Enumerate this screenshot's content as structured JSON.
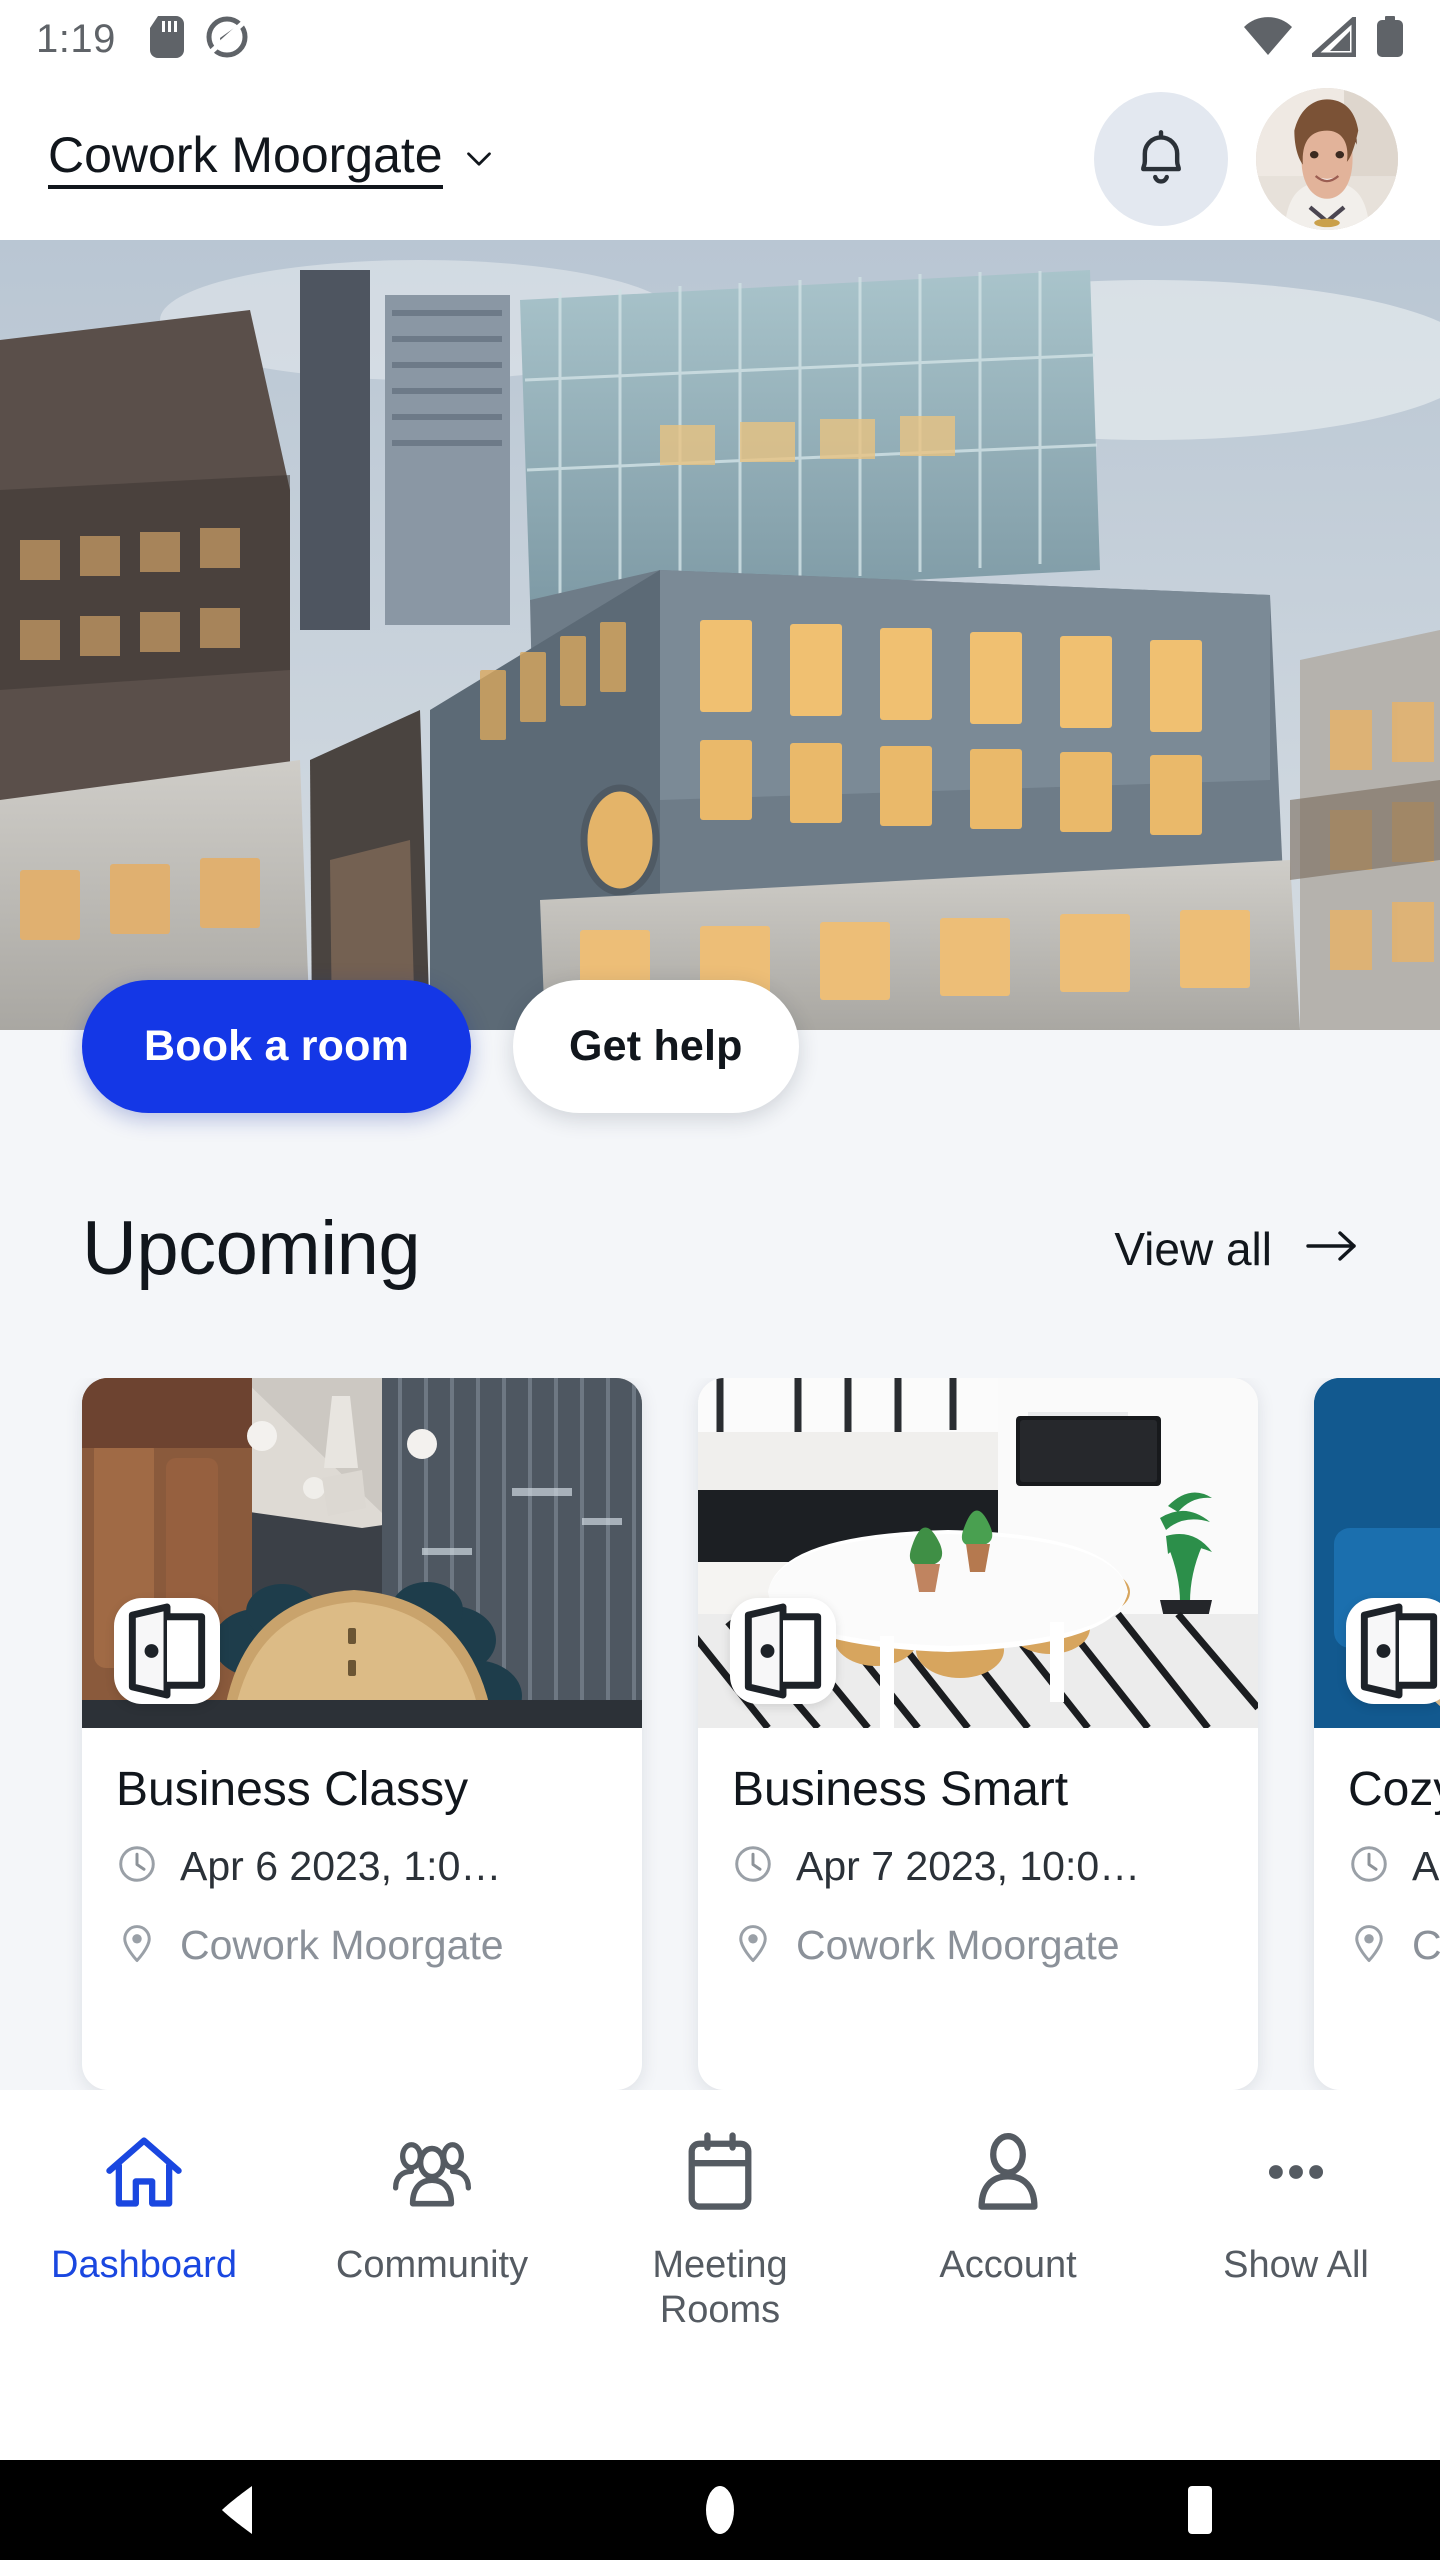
{
  "status_bar": {
    "time": "1:19",
    "left_icons": [
      "sd-card-icon",
      "screen-capture-icon"
    ],
    "right_icons": [
      "wifi-icon",
      "cellular-signal-icon",
      "battery-icon"
    ]
  },
  "header": {
    "venue_name": "Cowork Moorgate",
    "chevron": "chevron-down-icon",
    "notifications": "bell-icon",
    "avatar": "user-avatar"
  },
  "hero": {
    "alt": "aerial-view-of-london-office-buildings-at-dusk"
  },
  "cta": {
    "primary_label": "Book a room",
    "secondary_label": "Get help"
  },
  "upcoming": {
    "title": "Upcoming",
    "view_all_label": "View all",
    "view_all_icon": "arrow-right-icon",
    "cards": [
      {
        "title": "Business Classy",
        "time": "Apr 6 2023, 1:0…",
        "location": "Cowork Moorgate",
        "badge_icon": "open-door-icon"
      },
      {
        "title": "Business Smart",
        "time": "Apr 7 2023, 10:0…",
        "location": "Cowork Moorgate",
        "badge_icon": "open-door-icon"
      },
      {
        "title": "Cozy",
        "time": "A",
        "location": "C",
        "badge_icon": "open-door-icon"
      }
    ]
  },
  "bottom_nav": {
    "active_color": "#1a47e0",
    "inactive_color": "#555b62",
    "items": [
      {
        "label": "Dashboard",
        "icon": "home-icon",
        "active": true
      },
      {
        "label": "Community",
        "icon": "people-icon",
        "active": false
      },
      {
        "label": "Meeting Rooms",
        "icon": "calendar-icon",
        "active": false
      },
      {
        "label": "Account",
        "icon": "person-icon",
        "active": false
      },
      {
        "label": "Show All",
        "icon": "ellipsis-icon",
        "active": false
      }
    ]
  },
  "system_nav": {
    "back": "back-triangle-icon",
    "home": "home-circle-icon",
    "recents": "recents-square-icon"
  },
  "colors": {
    "brand_blue": "#1437e6",
    "page_background": "#f4f6f9",
    "surface": "#ffffff",
    "text_primary": "#11161c",
    "text_muted": "#8b9199"
  }
}
